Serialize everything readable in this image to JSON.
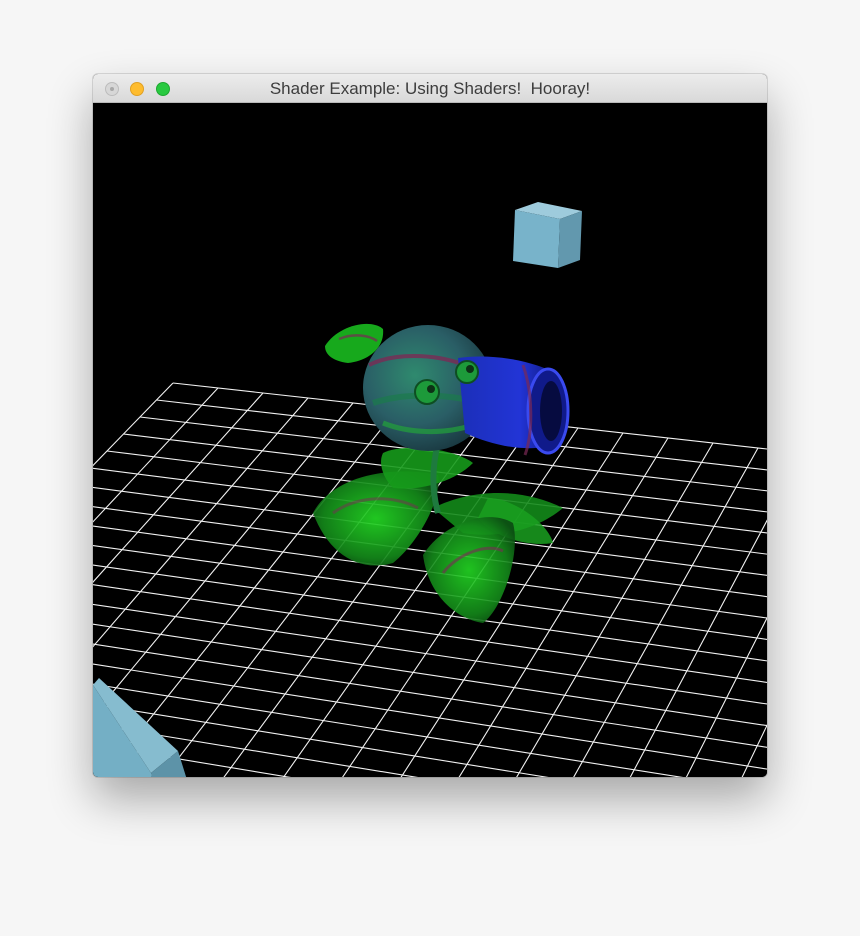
{
  "window": {
    "title": "Shader Example: Using Shaders!  Hooray!",
    "controls": [
      "close",
      "minimize",
      "zoom"
    ]
  },
  "scene": {
    "background_color": "#000000",
    "grid_color": "#ffffff",
    "objects": [
      {
        "name": "floor-grid",
        "kind": "wireframe grid"
      },
      {
        "name": "light-cube-far",
        "kind": "cube",
        "color": "#6fa7bf"
      },
      {
        "name": "light-cube-near",
        "kind": "cube",
        "color": "#6fa7bf"
      },
      {
        "name": "peashooter-model",
        "kind": "mesh",
        "colors": [
          "#15b515",
          "#1a2ac8",
          "#3a6e7a",
          "#7a2a55"
        ]
      }
    ]
  }
}
